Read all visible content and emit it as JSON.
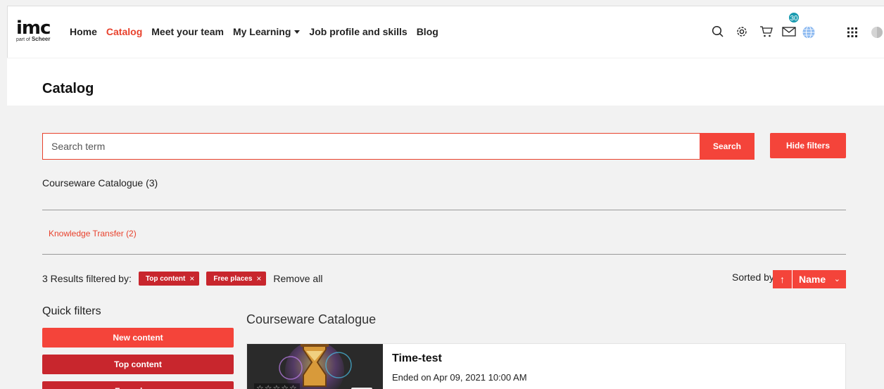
{
  "header": {
    "logo_main": "imc",
    "logo_sub_prefix": "part of",
    "logo_sub_brand": "Scheer",
    "nav": [
      {
        "label": "Home",
        "active": false
      },
      {
        "label": "Catalog",
        "active": true
      },
      {
        "label": "Meet your team",
        "active": false
      },
      {
        "label": "My Learning",
        "active": false,
        "dropdown": true
      },
      {
        "label": "Job profile and skills",
        "active": false
      },
      {
        "label": "Blog",
        "active": false
      }
    ],
    "icons": [
      "search-icon",
      "settings-gear-icon",
      "cart-icon",
      "mail-icon",
      "globe-icon",
      "apps-grid-icon",
      "avatar-icon"
    ],
    "mail_badge": "30"
  },
  "page": {
    "title": "Catalog"
  },
  "search": {
    "placeholder": "Search term",
    "value": "",
    "button_label": "Search",
    "hide_filters_label": "Hide filters"
  },
  "catalogue": {
    "label": "Courseware Catalogue (3)",
    "category_link": "Knowledge Transfer (2)"
  },
  "results": {
    "summary": "3 Results filtered by:",
    "chips": [
      {
        "label": "Top content",
        "remove": "×"
      },
      {
        "label": "Free places",
        "remove": "×"
      }
    ],
    "remove_all": "Remove all",
    "sorted_by_label": "Sorted by:",
    "sort_direction": "↑",
    "sort_field": "Name"
  },
  "quick_filters": {
    "title": "Quick filters",
    "buttons": [
      {
        "label": "New content",
        "selected": false
      },
      {
        "label": "Top content",
        "selected": true
      },
      {
        "label": "Free places",
        "selected": true
      }
    ]
  },
  "courseware": {
    "section_title": "Courseware Catalogue",
    "items": [
      {
        "title": "Time-test",
        "subtitle": "Ended on Apr 09, 2021 10:00 AM",
        "rating_stars": 0
      }
    ]
  },
  "colors": {
    "accent": "#f4443a",
    "accent_dark": "#c8262d",
    "badge": "#1a9bb0"
  }
}
